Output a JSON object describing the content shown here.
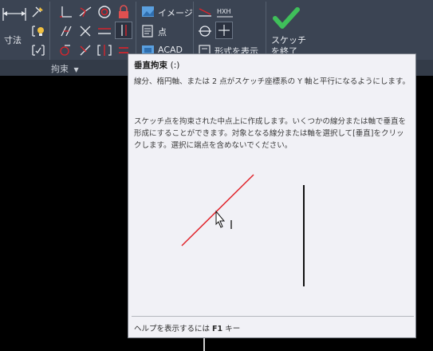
{
  "ribbon": {
    "dimension_label": "寸法",
    "panel_label": "拘束",
    "image_label": "イメージ",
    "point_label": "点",
    "acad_label": "ACAD",
    "show_format_label": "形式を表示",
    "finish_sketch_line1": "スケッチ",
    "finish_sketch_line2": "を終了"
  },
  "tooltip": {
    "title": "垂直拘束",
    "shortcut": "(:)",
    "description": "線分、楕円軸、または 2 点がスケッチ座標系の Y 軸と平行になるようにします。",
    "detail": "スケッチ点を拘束された中点上に作成します。いくつかの線分または軸で垂直を形成にすることができます。対象となる線分または軸を選択して[垂直]をクリックします。選択に端点を含めないでください。",
    "help_prefix": "ヘルプを表示するには",
    "help_key": "F1",
    "help_suffix": "キー"
  },
  "colors": {
    "ribbon_bg": "#3b4453",
    "tooltip_bg": "#f1f1f6",
    "accent_red": "#e0232a",
    "accent_green": "#3fbf5a",
    "lock_red": "#e05050"
  },
  "icons": [
    "dimension-icon",
    "fix-icon",
    "coincident-icon",
    "perpendicular-icon",
    "tangent-icon",
    "concentric-icon",
    "lock-icon",
    "collinear-icon",
    "parallel-icon",
    "horizontal-icon",
    "vertical-icon",
    "equal-icon",
    "symmetric-icon",
    "smooth-icon",
    "image-icon",
    "point-icon",
    "acad-icon",
    "check-icon"
  ]
}
